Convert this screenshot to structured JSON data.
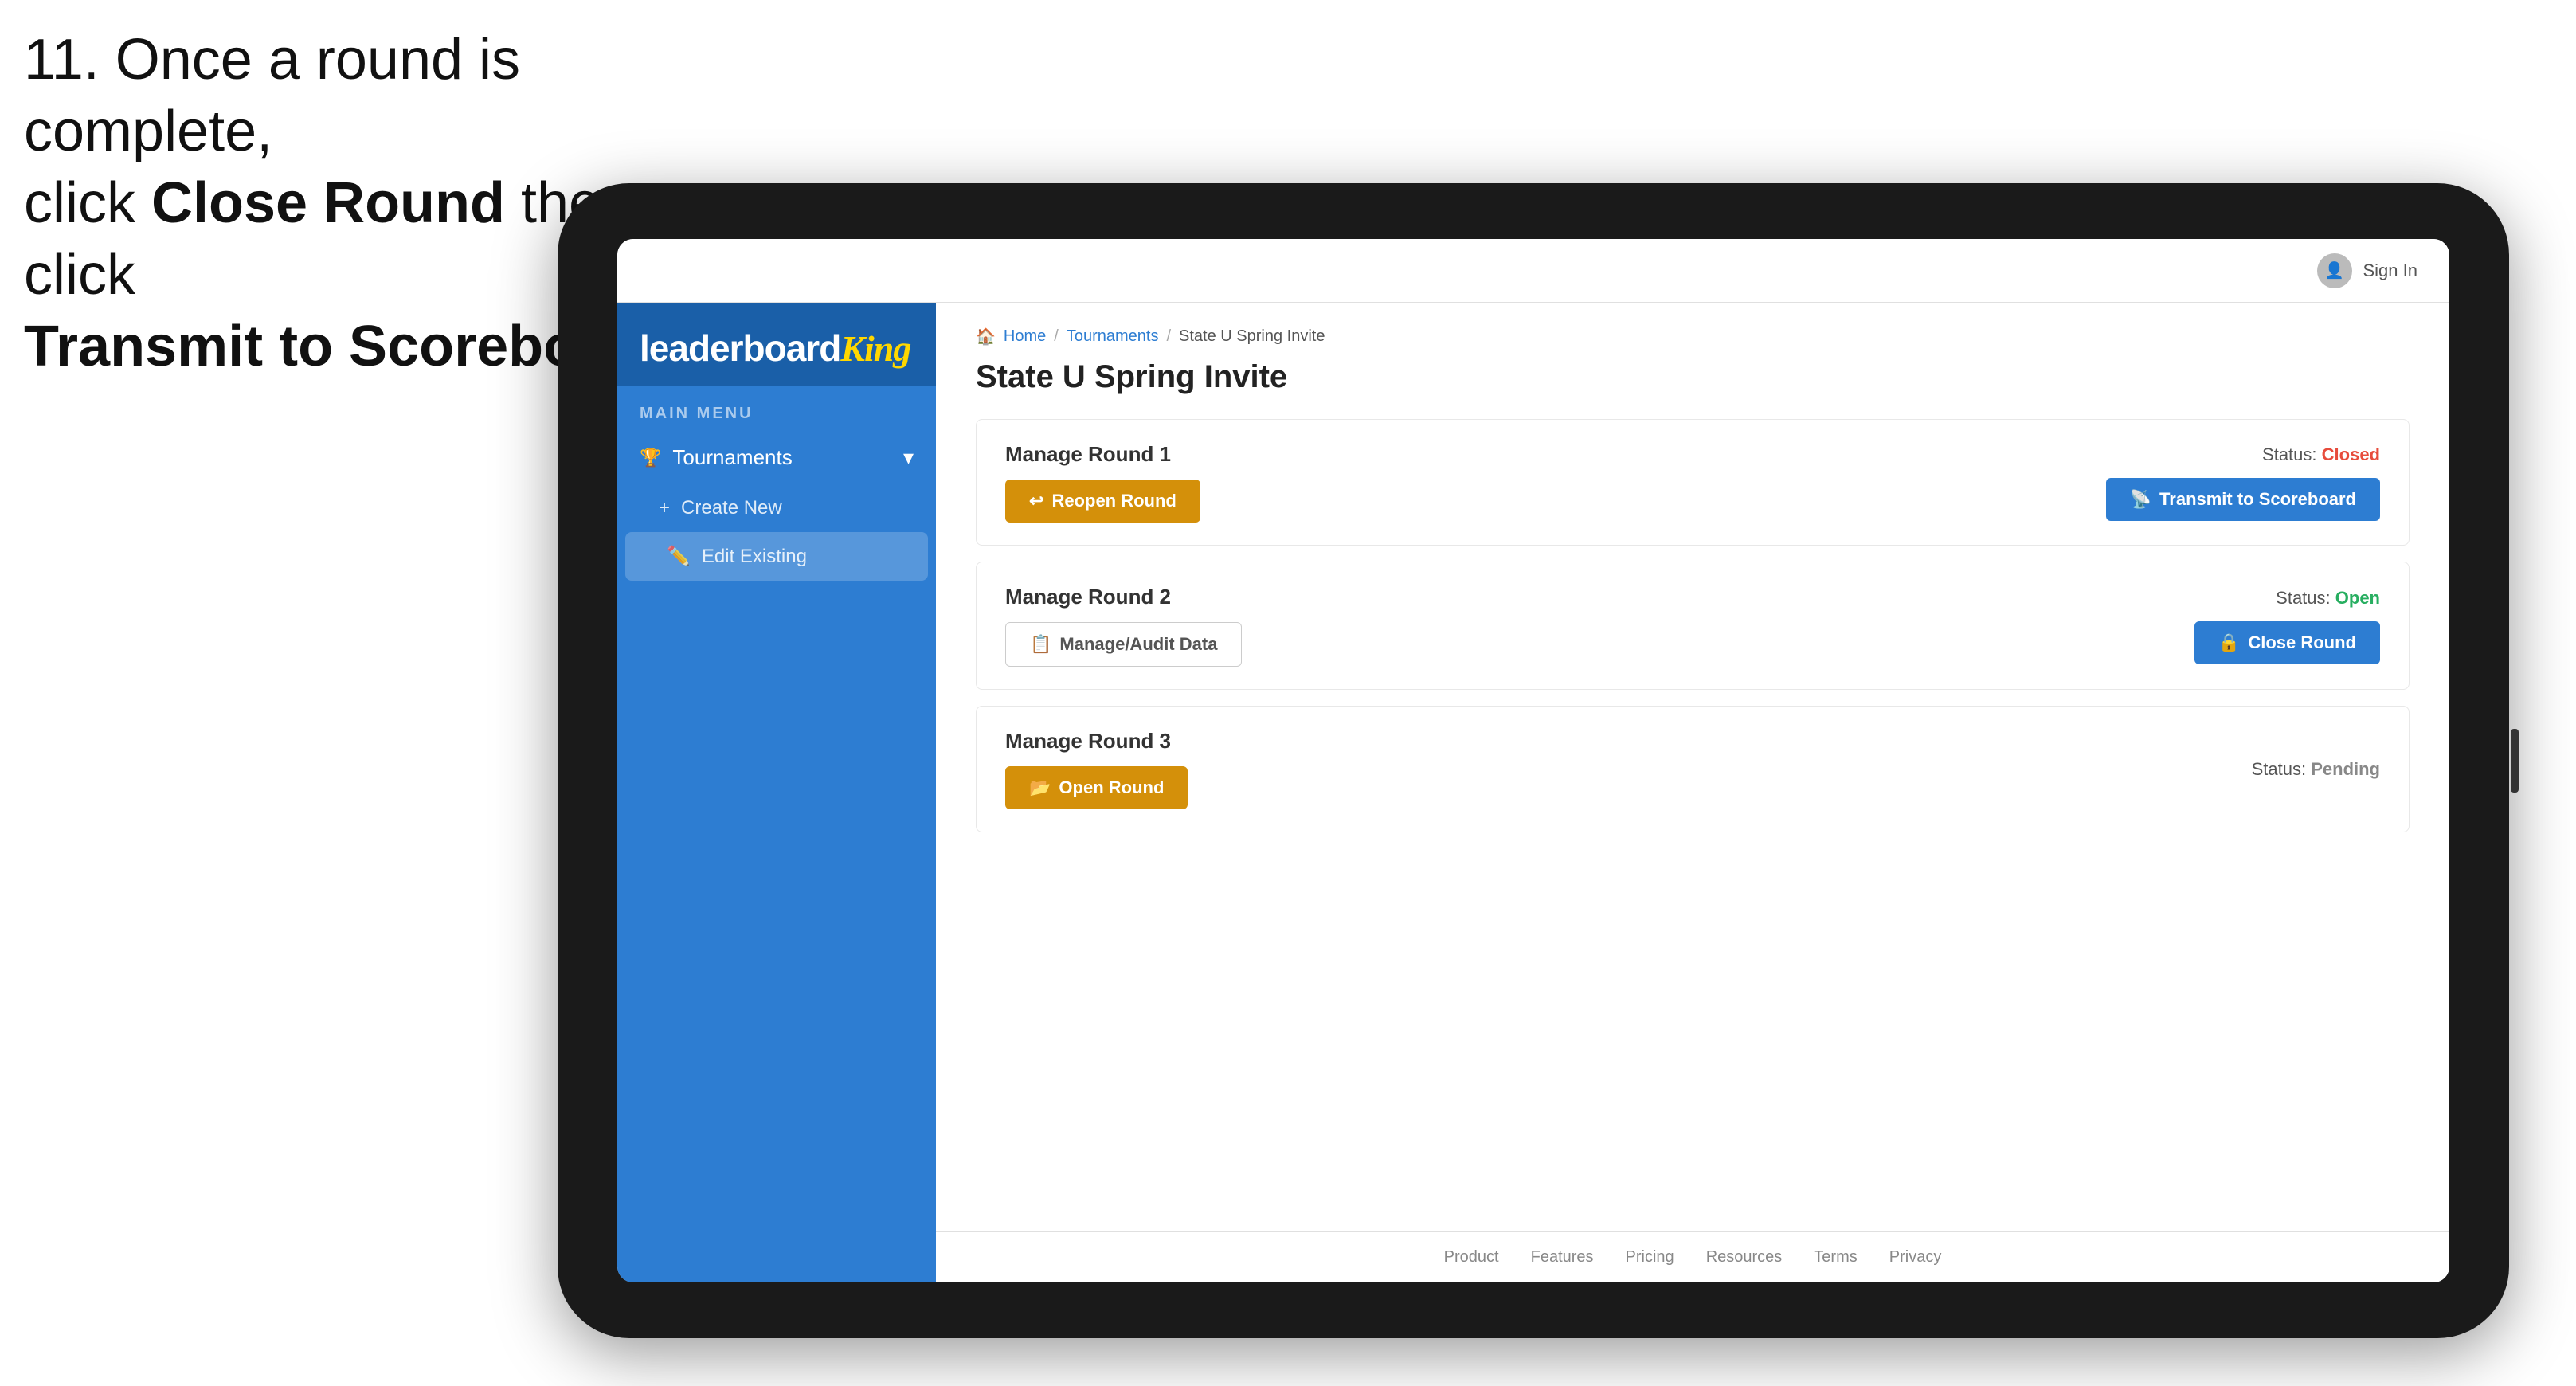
{
  "instruction": {
    "line1": "11. Once a round is complete,",
    "line2": "click ",
    "bold1": "Close Round",
    "line3": " then click",
    "bold2": "Transmit to Scoreboard."
  },
  "app": {
    "logo": {
      "leaderboard": "leaderboard",
      "king": "King"
    },
    "sidebar": {
      "menu_label": "MAIN MENU",
      "nav_items": [
        {
          "label": "Tournaments",
          "icon": "🏆",
          "expanded": true
        }
      ],
      "sub_items": [
        {
          "label": "Create New",
          "icon": "+",
          "active": false
        },
        {
          "label": "Edit Existing",
          "icon": "✏️",
          "active": true
        }
      ]
    },
    "topbar": {
      "sign_in": "Sign In"
    },
    "breadcrumb": {
      "home": "Home",
      "sep1": "/",
      "tournaments": "Tournaments",
      "sep2": "/",
      "current": "State U Spring Invite"
    },
    "page_title": "State U Spring Invite",
    "rounds": [
      {
        "title": "Manage Round 1",
        "status_label": "Status:",
        "status_value": "Closed",
        "status_type": "closed",
        "buttons": [
          {
            "label": "Reopen Round",
            "type": "gold",
            "icon": "↩"
          },
          {
            "label": "Transmit to Scoreboard",
            "type": "blue",
            "icon": "📡"
          }
        ]
      },
      {
        "title": "Manage Round 2",
        "status_label": "Status:",
        "status_value": "Open",
        "status_type": "open",
        "buttons": [
          {
            "label": "Manage/Audit Data",
            "type": "outline",
            "icon": "📋"
          },
          {
            "label": "Close Round",
            "type": "blue",
            "icon": "🔒"
          }
        ]
      },
      {
        "title": "Manage Round 3",
        "status_label": "Status:",
        "status_value": "Pending",
        "status_type": "pending",
        "buttons": [
          {
            "label": "Open Round",
            "type": "gold",
            "icon": "📂"
          }
        ]
      }
    ],
    "footer": {
      "links": [
        "Product",
        "Features",
        "Pricing",
        "Resources",
        "Terms",
        "Privacy"
      ]
    }
  }
}
